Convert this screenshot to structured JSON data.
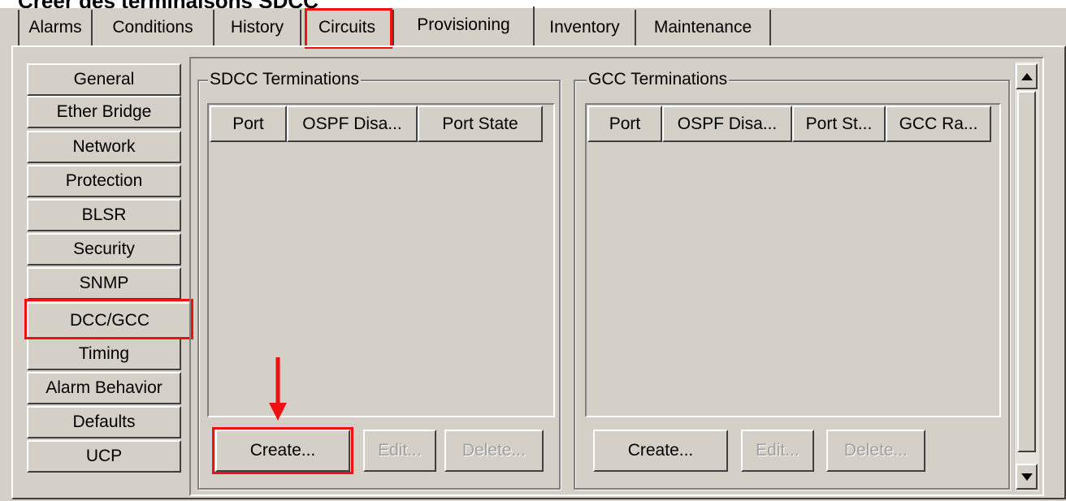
{
  "heading": "Créer des terminaisons SDCC",
  "tabs": [
    {
      "label": "Alarms"
    },
    {
      "label": "Conditions"
    },
    {
      "label": "History"
    },
    {
      "label": "Circuits"
    },
    {
      "label": "Provisioning"
    },
    {
      "label": "Inventory"
    },
    {
      "label": "Maintenance"
    }
  ],
  "active_tab": "Provisioning",
  "sidebar": {
    "items": [
      {
        "label": "General"
      },
      {
        "label": "Ether Bridge"
      },
      {
        "label": "Network"
      },
      {
        "label": "Protection"
      },
      {
        "label": "BLSR"
      },
      {
        "label": "Security"
      },
      {
        "label": "SNMP"
      },
      {
        "label": "DCC/GCC"
      },
      {
        "label": "Timing"
      },
      {
        "label": "Alarm Behavior"
      },
      {
        "label": "Defaults"
      },
      {
        "label": "UCP"
      }
    ],
    "selected": "DCC/GCC"
  },
  "sdcc": {
    "title": "SDCC Terminations",
    "columns": [
      "Port",
      "OSPF Disa...",
      "Port State"
    ],
    "rows": [],
    "buttons": {
      "create": "Create...",
      "edit": "Edit...",
      "delete": "Delete..."
    }
  },
  "gcc": {
    "title": "GCC Terminations",
    "columns": [
      "Port",
      "OSPF Disa...",
      "Port St...",
      "GCC Ra..."
    ],
    "rows": [],
    "buttons": {
      "create": "Create...",
      "edit": "Edit...",
      "delete": "Delete..."
    }
  },
  "annotations": {
    "highlight_color": "#ee1111",
    "highlighted": [
      "Circuits",
      "DCC/GCC",
      "Create..."
    ]
  },
  "icons": {
    "scroll_up": "scroll-up-arrow-icon",
    "scroll_down": "scroll-down-arrow-icon",
    "annotation_arrow": "red-down-arrow-icon"
  }
}
